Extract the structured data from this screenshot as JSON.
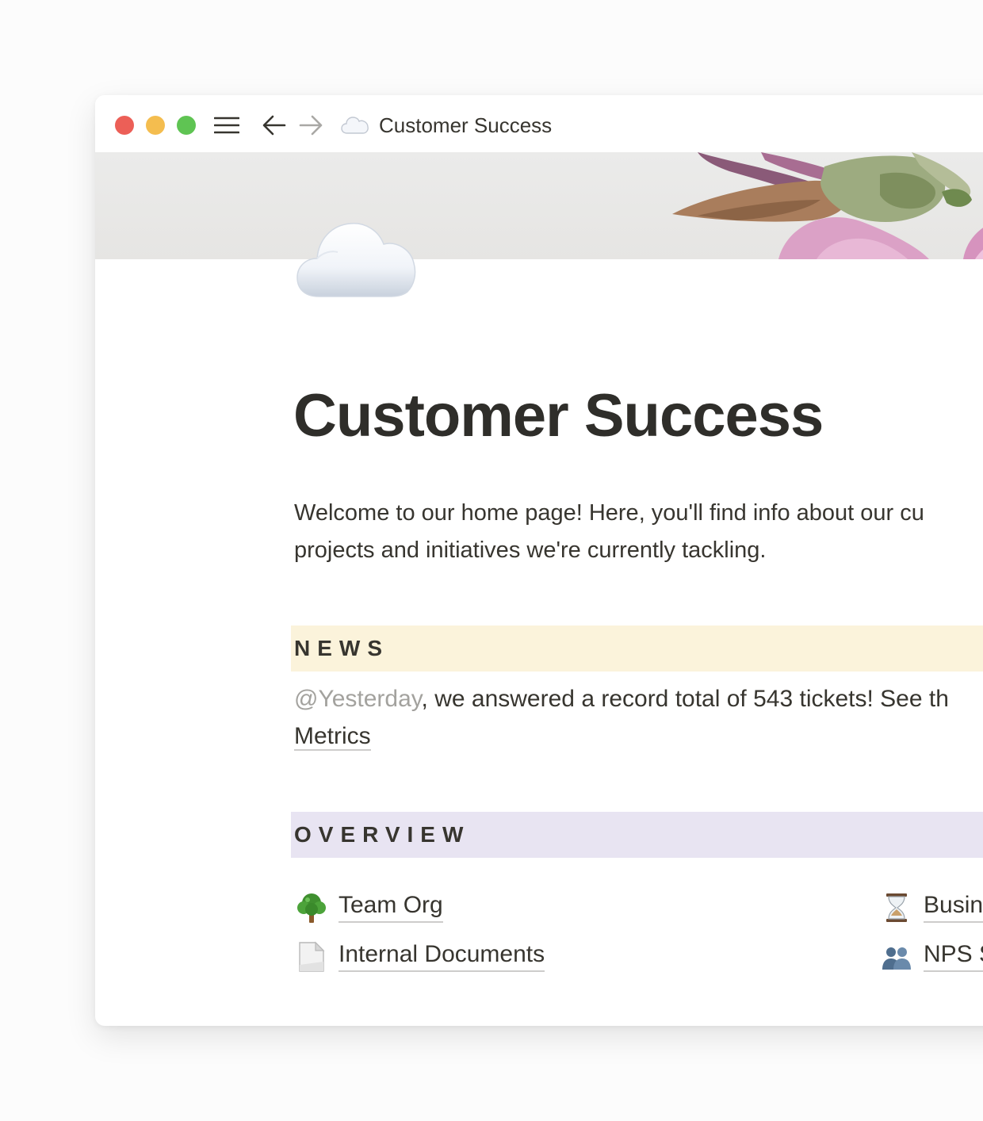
{
  "window": {
    "title": "Customer Success",
    "title_icon": "cloud-icon"
  },
  "page": {
    "icon": "cloud-icon",
    "title": "Customer Success",
    "intro_lines": [
      "Welcome to our home page! Here, you'll find info about our cu",
      "projects and initiatives we're currently tackling."
    ]
  },
  "news": {
    "heading": "NEWS",
    "color": "#fbf3db",
    "mention": "@Yesterday",
    "text": ", we answered a record total of 543 tickets! See th",
    "link": "Metrics"
  },
  "overview": {
    "heading": "OVERVIEW",
    "color": "#e8e4f2",
    "items": [
      {
        "icon": "tree-icon",
        "label": "Team Org"
      },
      {
        "icon": "document-icon",
        "label": "Internal Documents"
      },
      {
        "icon": "hourglass-icon",
        "label": "Busin"
      },
      {
        "icon": "people-icon",
        "label": "NPS S"
      }
    ]
  }
}
